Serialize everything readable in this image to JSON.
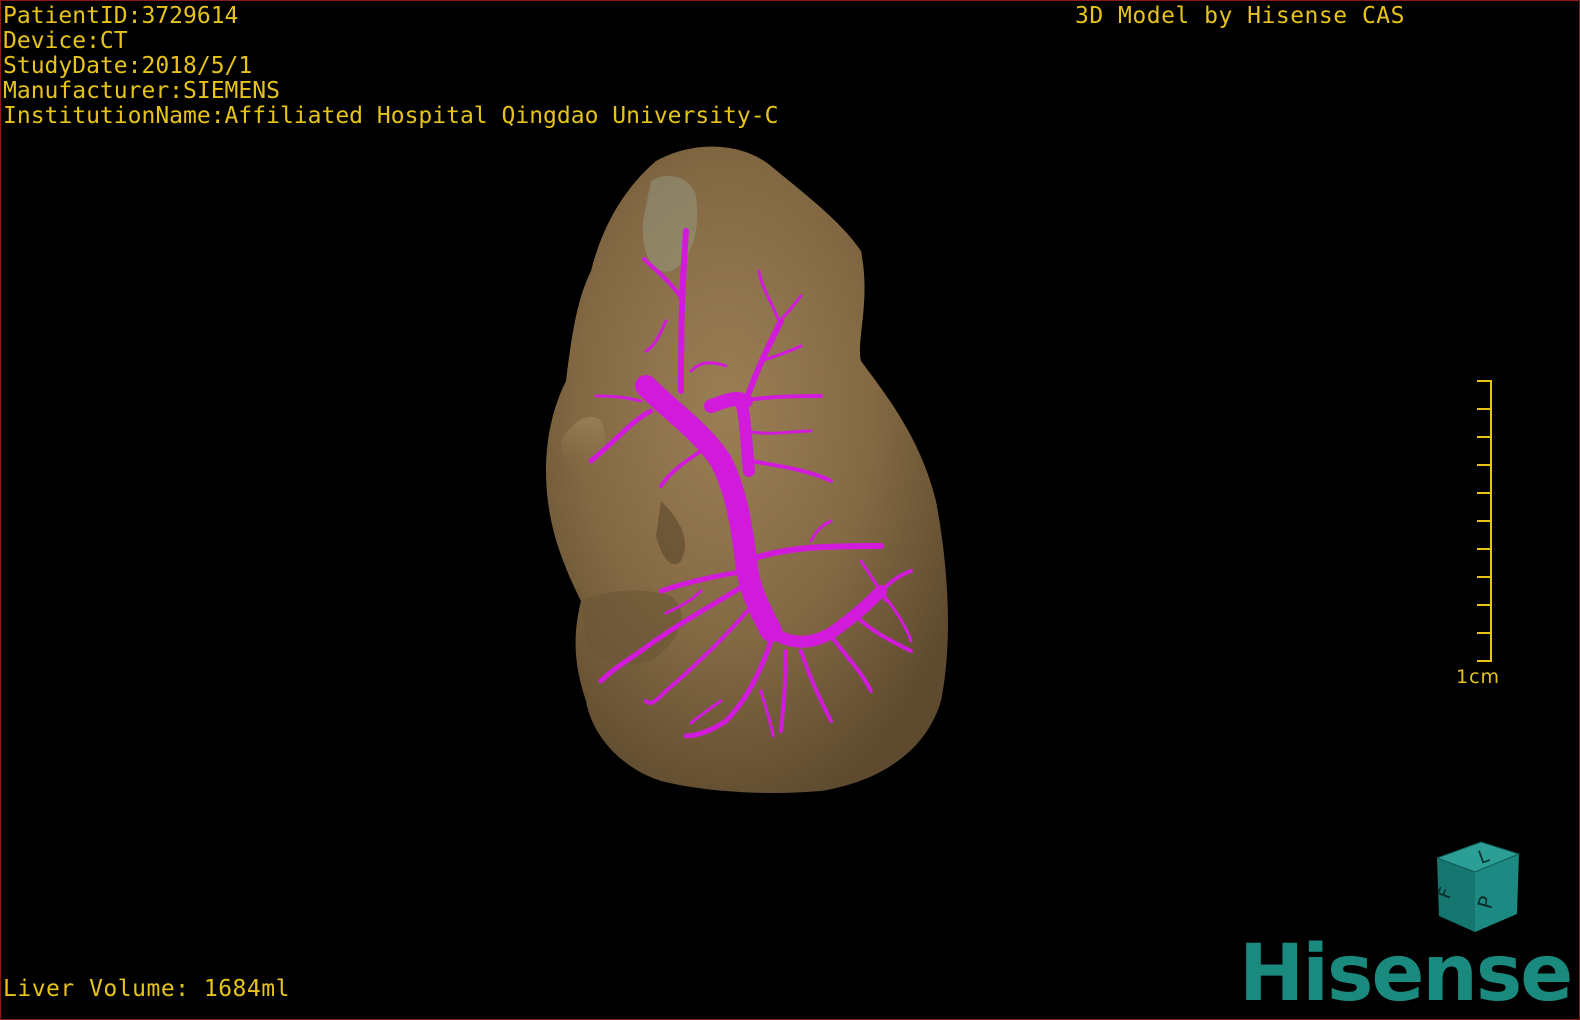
{
  "info": {
    "patient_id": "PatientID:3729614",
    "device": "Device:CT",
    "study_date": "StudyDate:2018/5/1",
    "manufacturer": "Manufacturer:SIEMENS",
    "institution": "InstitutionName:Affiliated Hospital Qingdao University-C"
  },
  "credit": "3D Model by Hisense CAS",
  "volume": "Liver Volume: 1684ml",
  "scale": {
    "label": "1cm"
  },
  "orientation_cube": {
    "face_top": "L",
    "face_left": "F",
    "face_right": "P"
  },
  "logo": "Hisense",
  "colors": {
    "overlay_text": "#e6c318",
    "liver": "#8a7048",
    "vessel": "#d21adc",
    "logo": "#1a8a7e",
    "border": "#8a1a1a"
  },
  "icons": {
    "orientation": "orientation-cube-icon",
    "scale": "scale-bar-icon"
  }
}
